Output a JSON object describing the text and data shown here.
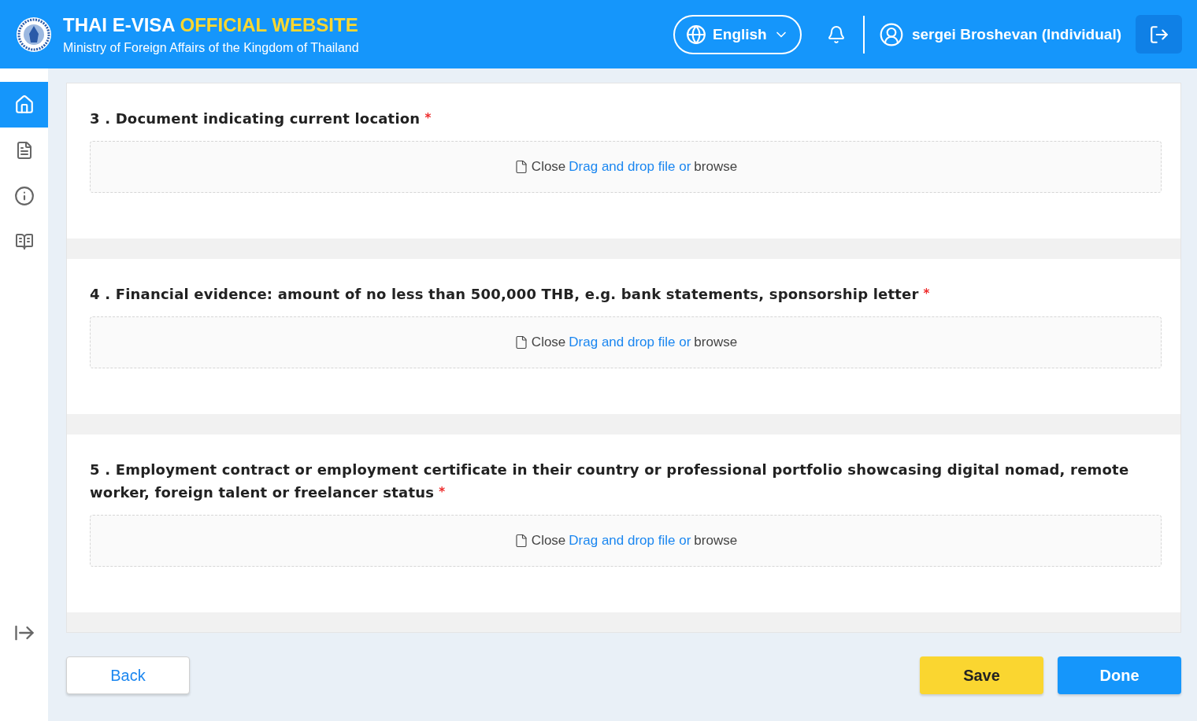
{
  "header": {
    "title": "THAI E-VISA",
    "title_highlight": "OFFICIAL WEBSITE",
    "subtitle": "Ministry of Foreign Affairs of the Kingdom of Thailand",
    "language": "English",
    "user": "sergei Broshevan (Individual)"
  },
  "sidebar": {
    "items": [
      {
        "kind": "home",
        "selected": true
      },
      {
        "kind": "document",
        "selected": false
      },
      {
        "kind": "info",
        "selected": false
      },
      {
        "kind": "manual",
        "selected": false
      }
    ]
  },
  "sections": [
    {
      "title": "3 . Document indicating current location",
      "required_mark": "*",
      "upload": {
        "close": "Close",
        "link": "Drag and drop file or",
        "browse": "browse"
      }
    },
    {
      "title": "4 . Financial evidence: amount of no less than 500,000 THB, e.g. bank statements, sponsorship letter",
      "required_mark": "*",
      "upload": {
        "close": "Close",
        "link": "Drag and drop file or",
        "browse": "browse"
      }
    },
    {
      "title": "5 . Employment contract or employment certificate in their country or professional portfolio showcasing digital nomad, remote worker, foreign talent or freelancer status",
      "required_mark": "*",
      "upload": {
        "close": "Close",
        "link": "Drag and drop file or",
        "browse": "browse"
      }
    }
  ],
  "buttons": {
    "back": "Back",
    "save": "Save",
    "done": "Done"
  }
}
